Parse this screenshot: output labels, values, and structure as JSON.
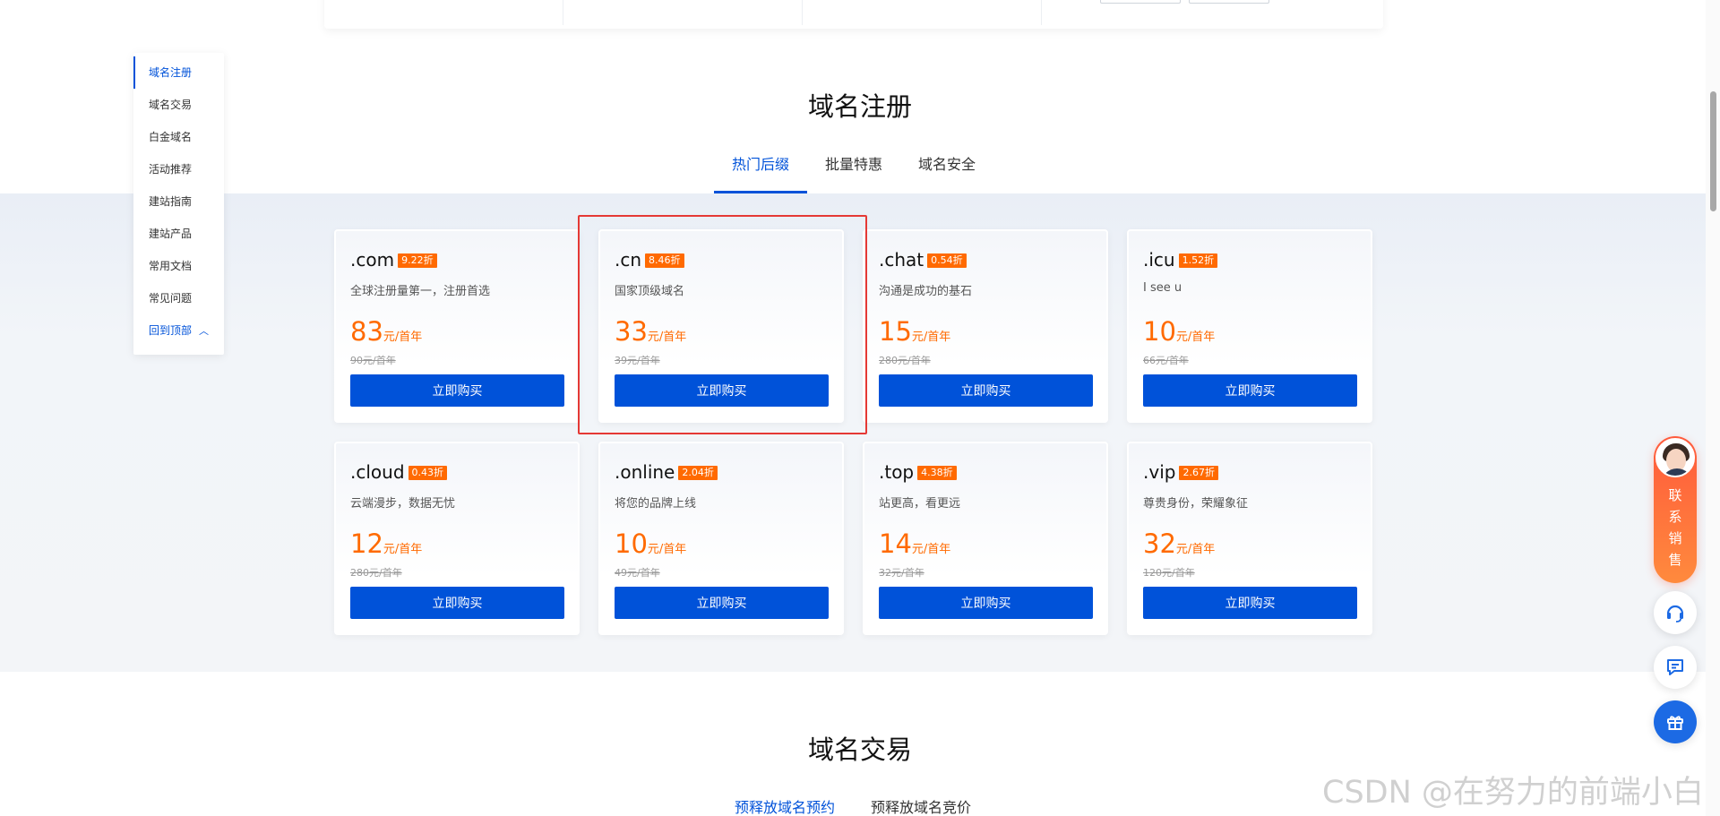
{
  "sidebar": {
    "items": [
      {
        "label": "域名注册",
        "active": true
      },
      {
        "label": "域名交易"
      },
      {
        "label": "白金域名"
      },
      {
        "label": "活动推荐"
      },
      {
        "label": "建站指南"
      },
      {
        "label": "建站产品"
      },
      {
        "label": "常用文档"
      },
      {
        "label": "常见问题"
      }
    ],
    "back_to_top": "回到顶部"
  },
  "section1": {
    "title": "域名注册",
    "tabs": [
      {
        "label": "热门后缀",
        "active": true
      },
      {
        "label": "批量特惠"
      },
      {
        "label": "域名安全"
      }
    ]
  },
  "cards": [
    {
      "name": ".com",
      "discount": "9.22折",
      "desc": "全球注册量第一，注册首选",
      "price": "83",
      "unit": "元/首年",
      "original": "90元/首年",
      "button": "立即购买"
    },
    {
      "name": ".cn",
      "discount": "8.46折",
      "desc": "国家顶级域名",
      "price": "33",
      "unit": "元/首年",
      "original": "39元/首年",
      "button": "立即购买"
    },
    {
      "name": ".chat",
      "discount": "0.54折",
      "desc": "沟通是成功的基石",
      "price": "15",
      "unit": "元/首年",
      "original": "280元/首年",
      "button": "立即购买"
    },
    {
      "name": ".icu",
      "discount": "1.52折",
      "desc": "I see u",
      "price": "10",
      "unit": "元/首年",
      "original": "66元/首年",
      "button": "立即购买"
    },
    {
      "name": ".cloud",
      "discount": "0.43折",
      "desc": "云端漫步，数据无忧",
      "price": "12",
      "unit": "元/首年",
      "original": "280元/首年",
      "button": "立即购买"
    },
    {
      "name": ".online",
      "discount": "2.04折",
      "desc": "将您的品牌上线",
      "price": "10",
      "unit": "元/首年",
      "original": "49元/首年",
      "button": "立即购买"
    },
    {
      "name": ".top",
      "discount": "4.38折",
      "desc": "站更高，看更远",
      "price": "14",
      "unit": "元/首年",
      "original": "32元/首年",
      "button": "立即购买"
    },
    {
      "name": ".vip",
      "discount": "2.67折",
      "desc": "尊贵身份，荣耀象征",
      "price": "32",
      "unit": "元/首年",
      "original": "120元/首年",
      "button": "立即购买"
    }
  ],
  "section2": {
    "title": "域名交易",
    "tabs": [
      {
        "label": "预释放域名预约",
        "active": true
      },
      {
        "label": "预释放域名竞价"
      }
    ]
  },
  "floating": {
    "contact_label": "联系销售",
    "icons": [
      "headset-icon",
      "message-icon",
      "gift-icon"
    ]
  },
  "watermark": "CSDN @在努力的前端小白",
  "colors": {
    "primary": "#0052d9",
    "discount_badge": "#ff6a00",
    "price": "#ff6a00",
    "highlight": "#e53935",
    "contact_gradient_top": "#ff5a3c"
  }
}
